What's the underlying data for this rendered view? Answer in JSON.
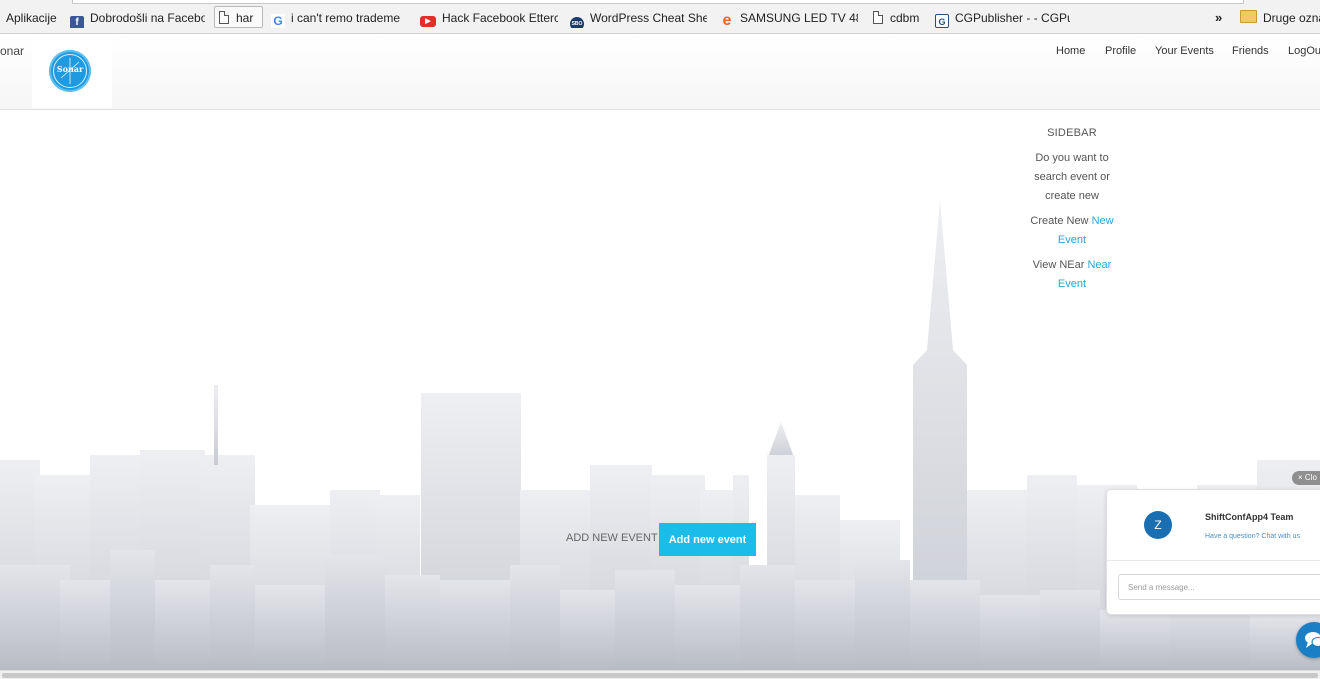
{
  "bookmarks_bar": {
    "items": [
      {
        "label": "Aplikacije",
        "icon": "apps-icon"
      },
      {
        "label": "Dobrodošli na Facebo",
        "icon": "facebook-icon",
        "icon_color": "#3b5998"
      },
      {
        "label": "har",
        "icon": "page-icon"
      },
      {
        "label": "i can't remo trademe",
        "icon": "google-icon",
        "icon_color": "#4285f4"
      },
      {
        "label": "Hack Facebook Etterc",
        "icon": "youtube-icon",
        "icon_color": "#e52d27"
      },
      {
        "label": "WordPress Cheat Shee",
        "icon": "sbo-icon",
        "icon_color": "#1b3a6b"
      },
      {
        "label": "SAMSUNG LED TV 48",
        "icon": "e-shop-icon",
        "icon_color": "#f26522"
      },
      {
        "label": "cdbm",
        "icon": "page-icon"
      },
      {
        "label": "CGPublisher - - CGPu",
        "icon": "cgpublisher-icon",
        "icon_color": "#2b4c7e"
      }
    ],
    "overflow": "»",
    "other_bookmarks": "Druge ozna"
  },
  "header": {
    "brand_text": "onar",
    "logo_text": "Sonar",
    "nav": [
      "Home",
      "Profile",
      "Your Events",
      "Friends",
      "LogOu"
    ]
  },
  "sidebar": {
    "title": "SIDEBAR",
    "question": "Do you want to search event or create new",
    "create_prefix": "Create New",
    "create_link": "New Event",
    "view_prefix": "View NEar",
    "view_link": "Near Event"
  },
  "main": {
    "add_label": "ADD NEW EVENT",
    "add_button": "Add new event"
  },
  "chat": {
    "close_label": "× Clo",
    "avatar_letter": "Z",
    "team_name": "ShiftConfApp4 Team",
    "subtitle": "Have a question? Chat with us",
    "input_placeholder": "Send a message...",
    "accent_color": "#1a7fc4"
  },
  "colors": {
    "button_bg": "#1bbde8",
    "link": "#2aa7d9",
    "skyline": "#d9dbe0"
  }
}
